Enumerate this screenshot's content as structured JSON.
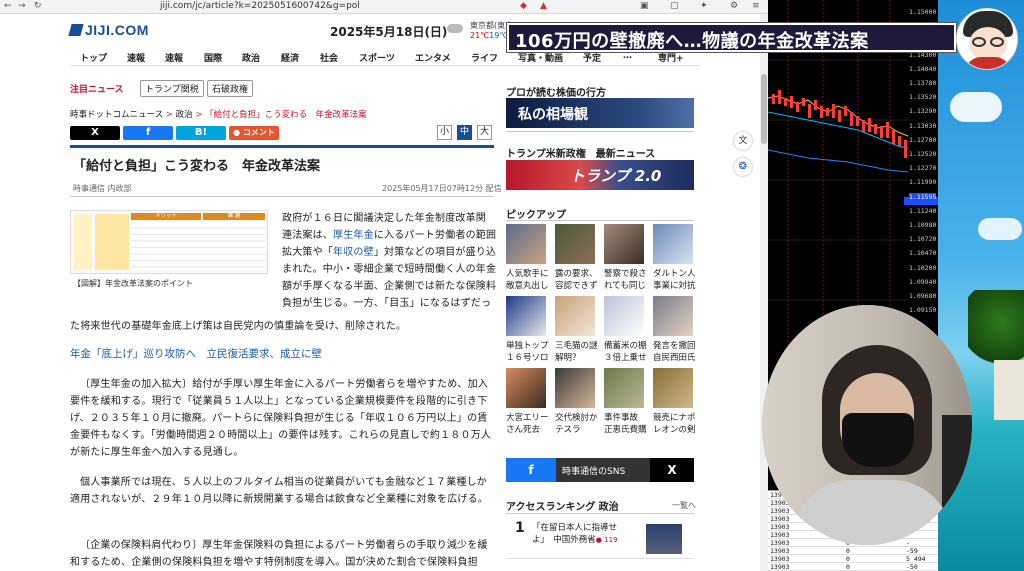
{
  "browser": {
    "url": "jiji.com/jc/article?k=2025051600742&g=pol"
  },
  "header": {
    "logo": "JIJI.COM",
    "date": "2025年5月18日(日)",
    "weather_city": "東京都(東京)",
    "temp_high": "21℃",
    "temp_low": "19℃"
  },
  "nav": {
    "items": [
      "トップ",
      "速報",
      "速報",
      "国際",
      "政治",
      "経済",
      "社会",
      "スポーツ",
      "エンタメ",
      "ライフ",
      "写真・動画",
      "予定",
      "…",
      "専門+"
    ]
  },
  "trending": {
    "label": "注目ニュース",
    "tags": [
      "トランプ関税",
      "石破政権"
    ]
  },
  "breadcrumb": {
    "items": [
      "時事ドットコムニュース",
      "政治",
      "「給付と負担」こう変わる　年金改革法案"
    ]
  },
  "share": {
    "x": "X",
    "facebook": "f",
    "hatena": "B!",
    "comment": "コメント"
  },
  "text_size": [
    "小",
    "中",
    "大"
  ],
  "article": {
    "title": "「給付と負担」こう変わる　年金改革法案",
    "source": "時事通信 内政部",
    "date": "2025年05月17日07時12分 配信",
    "figure_caption": "【図解】年金改革法案のポイント",
    "figure_headers": [
      "メリット",
      "課 題"
    ],
    "p1_a": "政府が１６日に閣議決定した年金制度改革関",
    "p1_b": "連法案は、",
    "p1_link1": "厚生年金",
    "p1_c": "に入るパート労働者の範囲",
    "p1_d": "拡大策や「",
    "p1_link2": "年収の壁",
    "p1_e": "」対策などの項目が盛り込",
    "p1_f": "まれた。中小・零細企業で短時間働く人の年金",
    "p1_g": "額が手厚くなる半面、企業側では新たな保険料",
    "p1_h": "負担が生じる。一方、「目玉」になるはずだっ",
    "p1_i": "た将来世代の基礎年金底上げ策は自民党内の慎重論を受け、削除された。",
    "related_link": "年金「底上げ」巡り攻防へ　立民復活要求、成立に壁",
    "p2": "〔厚生年金の加入拡大〕給付が手厚い厚生年金に入るパート労働者らを増やすため、加入要件を緩和する。現行で「従業員５１人以上」となっている企業規模要件を段階的に引き下げ、２０３５年１０月に撤廃。パートらに保険料負担が生じる「年収１０６万円以上」の賃金要件もなくす。「労働時間週２０時間以上」の要件は残す。これらの見直しで約１８０万人が新たに厚生年金へ加入する見通し。",
    "p3": "個人事業所では現在、５人以上のフルタイム相当の従業員がいても金融など１７業種しか適用されないが、２９年１０月以降に新規開業する場合は飲食など全業種に対象を広げる。",
    "p4": "〔企業の保険料肩代わり〕厚生年金保険料の負担によるパート労働者らの手取り減少を緩和するため、企業側の保険料負担を増やす特例制度を導入。国が決めた割合で保険料負担"
  },
  "sidebar": {
    "market_heading": "プロが読む株価の行方",
    "market_banner": "私の相場観",
    "trump_heading": "トランプ米新政権　最新ニュース",
    "trump_banner": "トランプ 2.0",
    "pickup_heading": "ピックアップ",
    "pickup": [
      [
        "人気歌手に",
        "敵意丸出し"
      ],
      [
        "露の要求、",
        "容認できず"
      ],
      [
        "警察で殺さ",
        "れても同じ"
      ],
      [
        "ダルトン人",
        "事業に対抗"
      ],
      [
        "単独トップ",
        "１６号ソロ"
      ],
      [
        "三毛猫の謎",
        "解明？"
      ],
      [
        "備蓄米の棚",
        "３倍上乗せ"
      ],
      [
        "発言を撤回",
        "自民西田氏"
      ],
      [
        "大宮エリー",
        "さん死去"
      ],
      [
        "交代検討か",
        "テスラ"
      ],
      [
        "事件事故",
        "正恵氏費購"
      ],
      [
        "競売にナポ",
        "レオンの剣"
      ]
    ],
    "sns_label": "時事通信のSNS",
    "ranking_heading": "アクセスランキング 政治",
    "ranking_more": "一覧へ",
    "rank1_num": "1",
    "rank1_title_a": "「在留日本人に指導せ",
    "rank1_title_b": "よ」　中国外務省",
    "rank1_count": "119"
  },
  "video_title": "106万円の壁撤廃へ…物議の年金改革法案",
  "chart_axis": {
    "ticks": [
      "1.15000",
      "1.14820",
      "1.14560",
      "1.14300",
      "1.14040",
      "1.13780",
      "1.13520",
      "1.13290",
      "1.13030",
      "1.12780",
      "1.12520",
      "1.12270",
      "1.11990",
      "1.11595",
      "1.11240",
      "1.10980",
      "1.10720",
      "1.10470",
      "1.10200",
      "1.09940",
      "1.09680",
      "1.09150"
    ],
    "highlight": "1.11595"
  },
  "order_table": {
    "rows": [
      [
        "13903",
        "0",
        "-"
      ],
      [
        "13903",
        "0",
        "-"
      ],
      [
        "13903",
        "0",
        "-"
      ],
      [
        "13903",
        "0",
        "-"
      ],
      [
        "13903",
        "0",
        "-"
      ],
      [
        "13903",
        "0",
        "-"
      ],
      [
        "13903",
        "0",
        "-"
      ],
      [
        "13903",
        "0",
        "-59"
      ],
      [
        "13903",
        "0",
        "5 494"
      ],
      [
        "13903",
        "0",
        "-50"
      ]
    ]
  },
  "colors": {
    "brand": "#1a4d99",
    "accent_red": "#c8102e",
    "title_bg": "#1f1a3c",
    "chart_bg": "#000000"
  }
}
